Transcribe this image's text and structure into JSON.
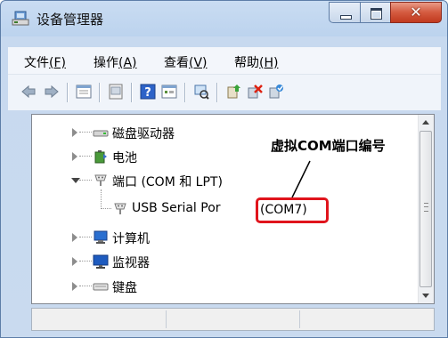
{
  "window": {
    "title": "设备管理器"
  },
  "menu": [
    {
      "text": "文件",
      "key": "(F)"
    },
    {
      "text": "操作",
      "key": "(A)"
    },
    {
      "text": "查看",
      "key": "(V)"
    },
    {
      "text": "帮助",
      "key": "(H)"
    }
  ],
  "toolbar": {
    "icons": [
      "back-icon",
      "forward-icon",
      "properties-list-icon",
      "device-icon",
      "help-icon",
      "view-icon",
      "scan-hardware-icon",
      "update-driver-icon",
      "uninstall-icon",
      "enable-device-icon"
    ]
  },
  "tree": {
    "items": [
      {
        "label": "磁盘驱动器",
        "icon": "disk-drive-icon",
        "expanded": false
      },
      {
        "label": "电池",
        "icon": "battery-icon",
        "expanded": false
      },
      {
        "label": "端口 (COM 和 LPT)",
        "icon": "port-icon",
        "expanded": true
      },
      {
        "label": "USB Serial Por",
        "icon": "serial-port-icon",
        "child": true
      },
      {
        "label": "计算机",
        "icon": "computer-icon",
        "expanded": false
      },
      {
        "label": "监视器",
        "icon": "monitor-icon",
        "expanded": false
      },
      {
        "label": "键盘",
        "icon": "keyboard-icon",
        "expanded": false
      }
    ]
  },
  "highlight": {
    "com_port": "(COM7)",
    "color": "#e0141c"
  },
  "annotation": {
    "text": "虚拟COM端口编号"
  },
  "colors": {
    "frame": "#c9dcf2",
    "close_button": "#c13a1f"
  }
}
